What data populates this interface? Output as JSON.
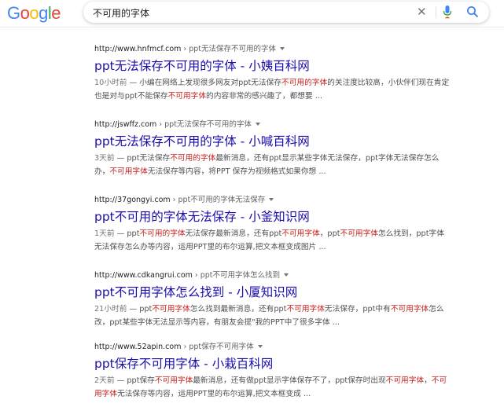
{
  "header": {
    "logo": [
      "G",
      "o",
      "o",
      "g",
      "l",
      "e"
    ],
    "logo_colors": [
      "#4285f4",
      "#ea4335",
      "#fbbc05",
      "#4285f4",
      "#34a853",
      "#ea4335"
    ],
    "query": "不可用的字体",
    "clear_icon": "close-icon",
    "mic_icon": "microphone-icon",
    "search_icon": "magnifier-icon"
  },
  "colors": {
    "title": "#1a0dab",
    "highlight": "#c5221f",
    "snippet": "#4d5156"
  },
  "results": [
    {
      "site": "http://www.hnfmcf.com",
      "path": " › ppt无法保存不可用的字体",
      "title": "ppt无法保存不可用的字体 - 小姨百科网",
      "date": "10小时前",
      "snippet": [
        {
          "t": " — 小编在网络上发现很多网友对ppt无法保存"
        },
        {
          "t": "不可用的字体",
          "hl": true
        },
        {
          "t": "的关注度比较高，小伙伴们现在肯定也是对与ppt不能保存"
        },
        {
          "t": "不可用字体",
          "hl": true
        },
        {
          "t": "的内容非常的感兴趣了，都想要 ..."
        }
      ]
    },
    {
      "site": "http://jswffz.com",
      "path": " › ppt无法保存不可用的字体",
      "title": "ppt无法保存不可用的字体 - 小喊百科网",
      "date": "3天前",
      "snippet": [
        {
          "t": " — ppt无法保存"
        },
        {
          "t": "不可用的字体",
          "hl": true
        },
        {
          "t": "最新消息，还有ppt显示某些字体无法保存，ppt字体无法保存怎么办，"
        },
        {
          "t": "不可用字体",
          "hl": true
        },
        {
          "t": "无法保存等内容，将PPT 保存为视频格式如果你想 ..."
        }
      ]
    },
    {
      "site": "http://37gongyi.com",
      "path": " › ppt不可用的字体无法保存",
      "title": "ppt不可用的字体无法保存 - 小釜知识网",
      "date": "1天前",
      "snippet": [
        {
          "t": " — ppt"
        },
        {
          "t": "不可用的字体",
          "hl": true
        },
        {
          "t": "无法保存最新消息，还有ppt"
        },
        {
          "t": "不可用字体",
          "hl": true
        },
        {
          "t": "，ppt"
        },
        {
          "t": "不可用字体",
          "hl": true
        },
        {
          "t": "怎么找到，ppt字体无法保存怎么办等内容，运用PPT里的布尔运算,把文本框变成图片 ..."
        }
      ]
    },
    {
      "site": "http://www.cdkangrui.com",
      "path": " › ppt不可用字体怎么找到",
      "title": "ppt不可用字体怎么找到 - 小厦知识网",
      "date": "21小时前",
      "snippet": [
        {
          "t": " — ppt"
        },
        {
          "t": "不可用字体",
          "hl": true
        },
        {
          "t": "怎么找到最新消息，还有ppt"
        },
        {
          "t": "不可用字体",
          "hl": true
        },
        {
          "t": "无法保存，ppt中有"
        },
        {
          "t": "不可用字体",
          "hl": true
        },
        {
          "t": "怎么改，ppt某些字体无法显示等内容，有朋友会提\"我的PPT中了很多字体 ..."
        }
      ]
    },
    {
      "site": "http://www.52apin.com",
      "path": " › ppt保存不可用字体",
      "title": "ppt保存不可用字体 - 小栽百科网",
      "date": "2天前",
      "snippet": [
        {
          "t": " — ppt保存"
        },
        {
          "t": "不可用字体",
          "hl": true
        },
        {
          "t": "最新消息，还有做ppt显示字体保存不了，ppt保存时出现"
        },
        {
          "t": "不可用字体",
          "hl": true
        },
        {
          "t": "，"
        },
        {
          "t": "不可用字体",
          "hl": true
        },
        {
          "t": "无法保存等内容，运用PPT里的布尔运算,把文本框变成 ..."
        }
      ]
    }
  ]
}
